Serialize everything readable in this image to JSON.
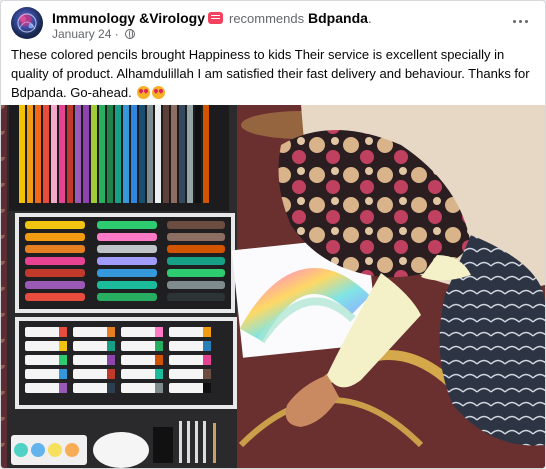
{
  "header": {
    "page_name": "Immunology &Virology",
    "verb": "recommends",
    "recommended_page": "Bdpanda",
    "trailing": ".",
    "date": "January 24",
    "separator": "·"
  },
  "post": {
    "text": "These colored pencils brought Happiness to kids Their service is excellent specially in quality of product. Alhamdulillah I am satisfied their fast delivery and behaviour. Thanks for Bdpanda. Go-ahead.",
    "emojis": [
      "heart-eyes-emoji",
      "heart-eyes-emoji"
    ]
  },
  "icons": {
    "recommend_badge": "recommend-icon",
    "privacy": "globe-icon",
    "menu": "more-options-icon"
  },
  "colors": {
    "name_text": "#050505",
    "secondary_text": "#65676b",
    "recommend_badge": "#f3425f"
  }
}
